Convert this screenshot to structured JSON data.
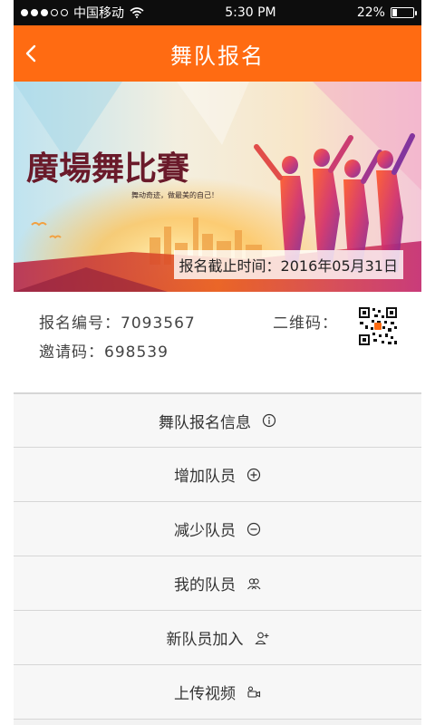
{
  "status_bar": {
    "carrier": "中国移动",
    "time": "5:30 PM",
    "battery": "22%",
    "battery_level": 0.22
  },
  "header": {
    "title": "舞队报名"
  },
  "banner": {
    "title": "廣場舞比賽",
    "slogan": "舞动奇迹，做最美的自己！",
    "deadline": "报名截止时间：2016年05月31日"
  },
  "info": {
    "reg_label": "报名编号：",
    "reg_number": "7093567",
    "invite_label": "邀请码：",
    "invite_code": "698539",
    "qr_label": "二维码："
  },
  "menu": [
    {
      "label": "舞队报名信息",
      "icon": "info-icon"
    },
    {
      "label": "增加队员",
      "icon": "plus-circle-icon"
    },
    {
      "label": "减少队员",
      "icon": "minus-circle-icon"
    },
    {
      "label": "我的队员",
      "icon": "group-icon"
    },
    {
      "label": "新队员加入",
      "icon": "add-user-icon"
    },
    {
      "label": "上传视频",
      "icon": "video-camera-icon"
    }
  ],
  "colors": {
    "header": "#ff6b12",
    "status_bar": "#0d0d0d",
    "background": "#f2f2f2"
  }
}
